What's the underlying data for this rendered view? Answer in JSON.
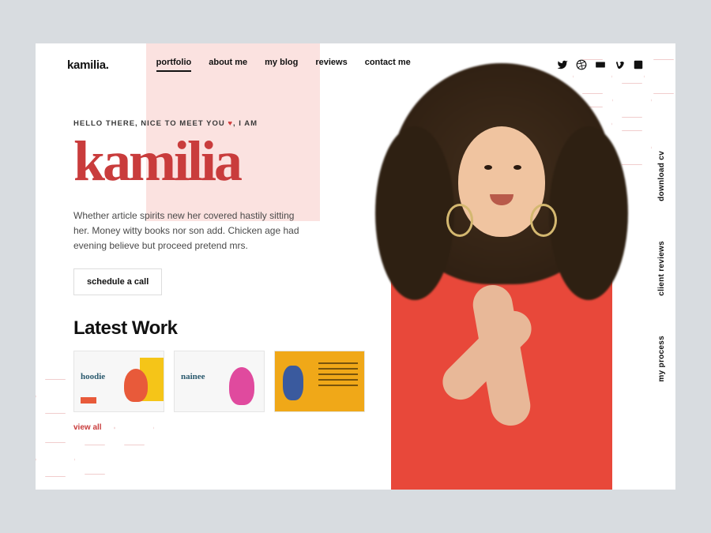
{
  "logo": "kamilia.",
  "nav": {
    "items": [
      {
        "label": "portfolio",
        "active": true
      },
      {
        "label": "about me",
        "active": false
      },
      {
        "label": "my blog",
        "active": false
      },
      {
        "label": "reviews",
        "active": false
      },
      {
        "label": "contact me",
        "active": false
      }
    ]
  },
  "hero": {
    "eyebrow_pre": "HELLO THERE, NICE TO MEET YOU ",
    "eyebrow_heart": "♥",
    "eyebrow_post": ", I AM",
    "name": "kamilia",
    "description": "Whether article spirits new her covered hastily sitting her. Money witty books nor son add. Chicken age had evening believe but proceed pretend mrs.",
    "cta": "schedule a call"
  },
  "latest": {
    "title": "Latest Work",
    "cards": [
      {
        "label": "hoodie"
      },
      {
        "label": "nainee"
      },
      {
        "label": ""
      }
    ],
    "view_all": "view all"
  },
  "side": {
    "links": [
      {
        "label": "download cv"
      },
      {
        "label": "client reviews"
      },
      {
        "label": "my process"
      }
    ]
  },
  "socials": [
    {
      "name": "twitter"
    },
    {
      "name": "dribbble"
    },
    {
      "name": "behance"
    },
    {
      "name": "vimeo"
    },
    {
      "name": "linkedin"
    }
  ]
}
